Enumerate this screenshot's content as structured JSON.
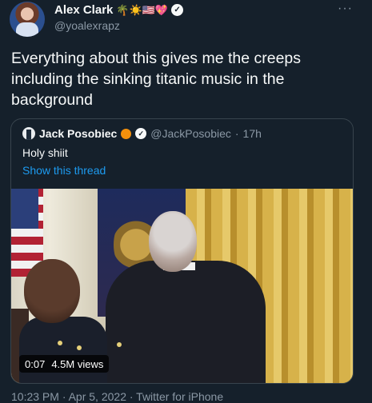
{
  "author": {
    "name": "Alex Clark",
    "name_emojis": "🌴☀️🇺🇸💖",
    "handle": "@yoalexrapz",
    "verified_icon": "verified-badge-icon"
  },
  "more_label": "···",
  "text": "Everything about this gives me the creeps including the sinking titanic music in the background",
  "quoted": {
    "name": "Jack Posobiec",
    "handle": "@JackPosobiec",
    "separator": "·",
    "time": "17h",
    "text": "Holy shiit",
    "show_thread": "Show this thread"
  },
  "media": {
    "duration": "0:07",
    "views": "4.5M views"
  },
  "footer": "10:23 PM · Apr 5, 2022 · Twitter for iPhone",
  "colors": {
    "background": "#15202b",
    "link": "#1d9bf0",
    "muted": "#8b98a5"
  }
}
